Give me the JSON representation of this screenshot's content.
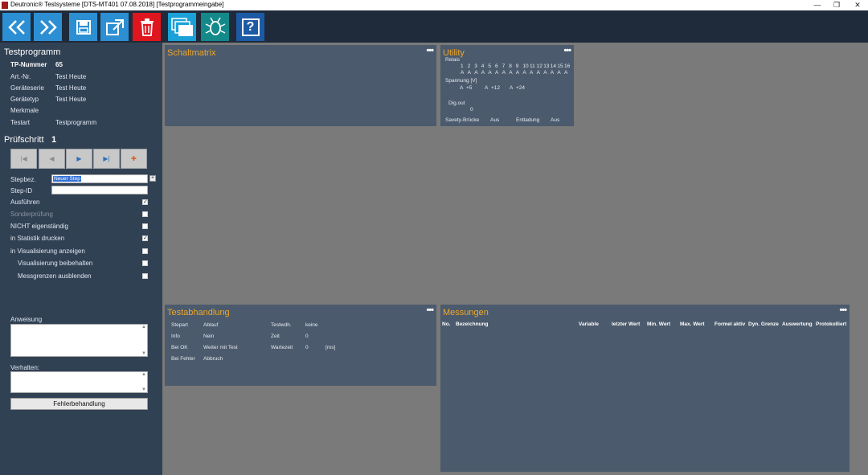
{
  "window": {
    "title": "Deutronic® Testsysteme [DTS-MT401  07.08.2018] [Testprogrammeingabe]",
    "minimize": "—",
    "maximize": "❐",
    "close": "✕"
  },
  "toolbar": {
    "buttons": [
      {
        "icon": "double-chevron-left-icon",
        "color": "#2d8fd3"
      },
      {
        "icon": "double-chevron-right-icon",
        "color": "#2d8fd3"
      },
      {
        "icon": "save-icon",
        "color": "#2d8fd3"
      },
      {
        "icon": "export-icon",
        "color": "#2d8fd3"
      },
      {
        "icon": "trash-icon",
        "color": "#e0161f"
      },
      {
        "icon": "windows-icon",
        "color": "#1aa1d8"
      },
      {
        "icon": "bug-icon",
        "color": "#13898a"
      },
      {
        "icon": "help-icon",
        "color": "#1d5aa5"
      }
    ],
    "help_label": "?"
  },
  "testprogramm": {
    "heading": "Testprogramm",
    "rows": [
      {
        "label": "TP-Nummer",
        "value": "65"
      },
      {
        "label": "Art.-Nr.",
        "value": "Test Heute"
      },
      {
        "label": "Geräteserie",
        "value": "Test Heute"
      },
      {
        "label": "Gerätetyp",
        "value": "Test Heute"
      },
      {
        "label": "Merkmale",
        "value": ""
      },
      {
        "label": "Testart",
        "value": "Testprogramm"
      }
    ]
  },
  "pruefschritt": {
    "heading": "Prüfschritt",
    "number": "1",
    "nav": [
      "|◀",
      "◀",
      "▶",
      "▶|",
      "✚"
    ],
    "stepbez_label": "Stepbez.",
    "stepbez_value": "Neuer Step",
    "stepid_label": "Step-ID",
    "stepid_value": "",
    "plus": "+",
    "options": [
      {
        "label": "Ausführen",
        "checked": true,
        "disabled": false
      },
      {
        "label": "Sonderprüfung",
        "checked": false,
        "disabled": true
      },
      {
        "label": "NICHT eigenständig",
        "checked": false,
        "disabled": false
      },
      {
        "label": "in Statistik drucken",
        "checked": true,
        "disabled": false
      },
      {
        "label": "in Visualisierung anzeigen",
        "checked": false,
        "disabled": false
      },
      {
        "label": "Visualisierung beibehalten",
        "checked": false,
        "disabled": false
      },
      {
        "label": "Messgrenzen ausblenden",
        "checked": false,
        "disabled": false
      }
    ],
    "anweisung_label": "Anweisung",
    "verhalten_label": "Verhalten:",
    "fehler_button": "Fehlerbehandlung"
  },
  "schaltmatrix": {
    "title": "Schaltmatrix",
    "dots": "•••"
  },
  "utility": {
    "title": "Utility",
    "dots": "•••",
    "relais_label": "Relais",
    "relais_numbers": [
      "1",
      "2",
      "3",
      "4",
      "5",
      "6",
      "7",
      "8",
      "9",
      "10",
      "11",
      "12",
      "13",
      "14",
      "15",
      "16"
    ],
    "relais_states": [
      "A",
      "A",
      "A",
      "A",
      "A",
      "A",
      "A",
      "A",
      "A",
      "A",
      "A",
      "A",
      "A",
      "A",
      "A",
      "A"
    ],
    "spannung_label": "Spannung [V]",
    "spannung": [
      {
        "state": "A",
        "label": "+5"
      },
      {
        "state": "A",
        "label": "+12"
      },
      {
        "state": "A",
        "label": "+24"
      }
    ],
    "digout_label": "Dig.out",
    "digout_value": "0",
    "savety_label": "Savety-Brücke",
    "savety_value": "Aus",
    "entladung_label": "Entladung",
    "entladung_value": "Aus"
  },
  "testabhandlung": {
    "title": "Testabhandlung",
    "dots": "•••",
    "left": [
      {
        "label": "Stepart",
        "value": "Ablauf"
      },
      {
        "label": "Info",
        "value": "Nein"
      },
      {
        "label": "Bei OK",
        "value": "Weiter mit Test"
      },
      {
        "label": "Bei Fehler",
        "value": "Abbruch"
      }
    ],
    "right": [
      {
        "label": "Testwdh.",
        "value": "keine",
        "unit": ""
      },
      {
        "label": "Zeit",
        "value": "0",
        "unit": ""
      },
      {
        "label": "Wartezeit",
        "value": "0",
        "unit": "[ms]"
      }
    ]
  },
  "messungen": {
    "title": "Messungen",
    "dots": "•••",
    "columns": [
      "No.",
      "Bezeichnung",
      "Variable",
      "letzter Wert",
      "Min. Wert",
      "Max. Wert",
      "Formel aktiv",
      "Dyn. Grenze",
      "Auswertung",
      "Protokolliert"
    ]
  }
}
